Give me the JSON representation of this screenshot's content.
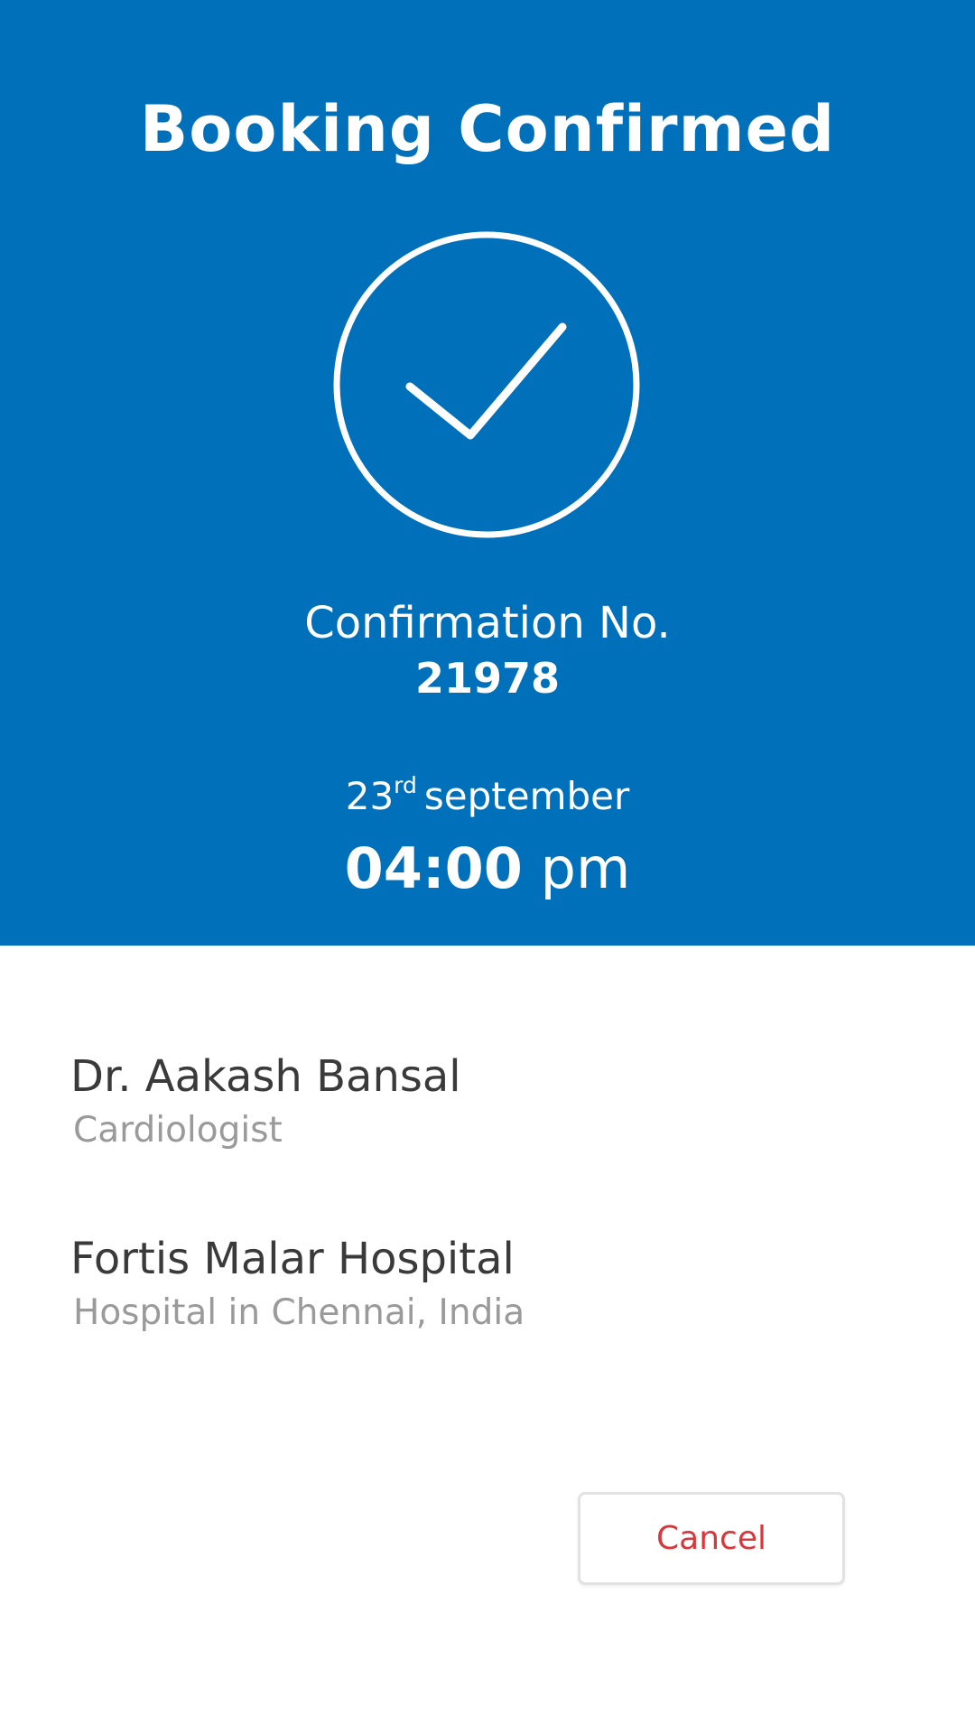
{
  "header": {
    "title": "Booking Confirmed",
    "background_color": "#0070bb",
    "status_icon": "check-circle-icon"
  },
  "confirmation": {
    "label": "Confirmation No.",
    "number": "21978"
  },
  "appointment": {
    "day": "23",
    "day_suffix": "rd",
    "month": "september",
    "time": "04:00",
    "meridiem": "pm"
  },
  "doctor": {
    "name": "Dr. Aakash Bansal",
    "specialty": "Cardiologist"
  },
  "hospital": {
    "name": "Fortis Malar Hospital",
    "location": "Hospital in Chennai, India"
  },
  "actions": {
    "cancel_label": "Cancel",
    "cancel_color": "#d9373b"
  }
}
